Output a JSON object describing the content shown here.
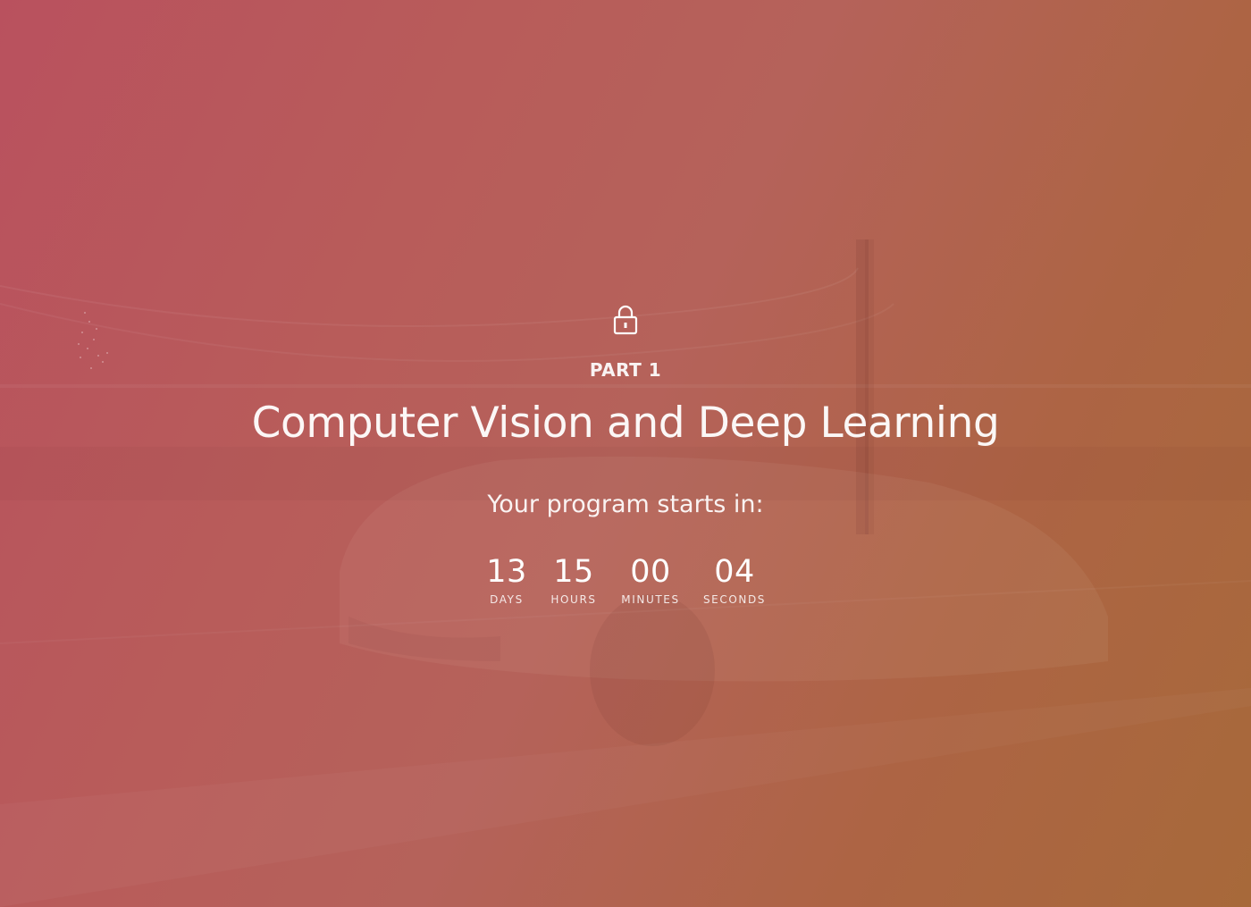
{
  "program": {
    "part_label": "PART 1",
    "title": "Computer Vision and Deep Learning",
    "starts_in_label": "Your program starts in:",
    "lock_icon": "lock-icon"
  },
  "countdown": {
    "days": {
      "value": "13",
      "label": "Days"
    },
    "hours": {
      "value": "15",
      "label": "Hours"
    },
    "minutes": {
      "value": "00",
      "label": "Minutes"
    },
    "seconds": {
      "value": "04",
      "label": "Seconds"
    }
  },
  "colors": {
    "gradient_start": "#b9515e",
    "gradient_end": "#a7693a",
    "text": "#ffffff"
  }
}
